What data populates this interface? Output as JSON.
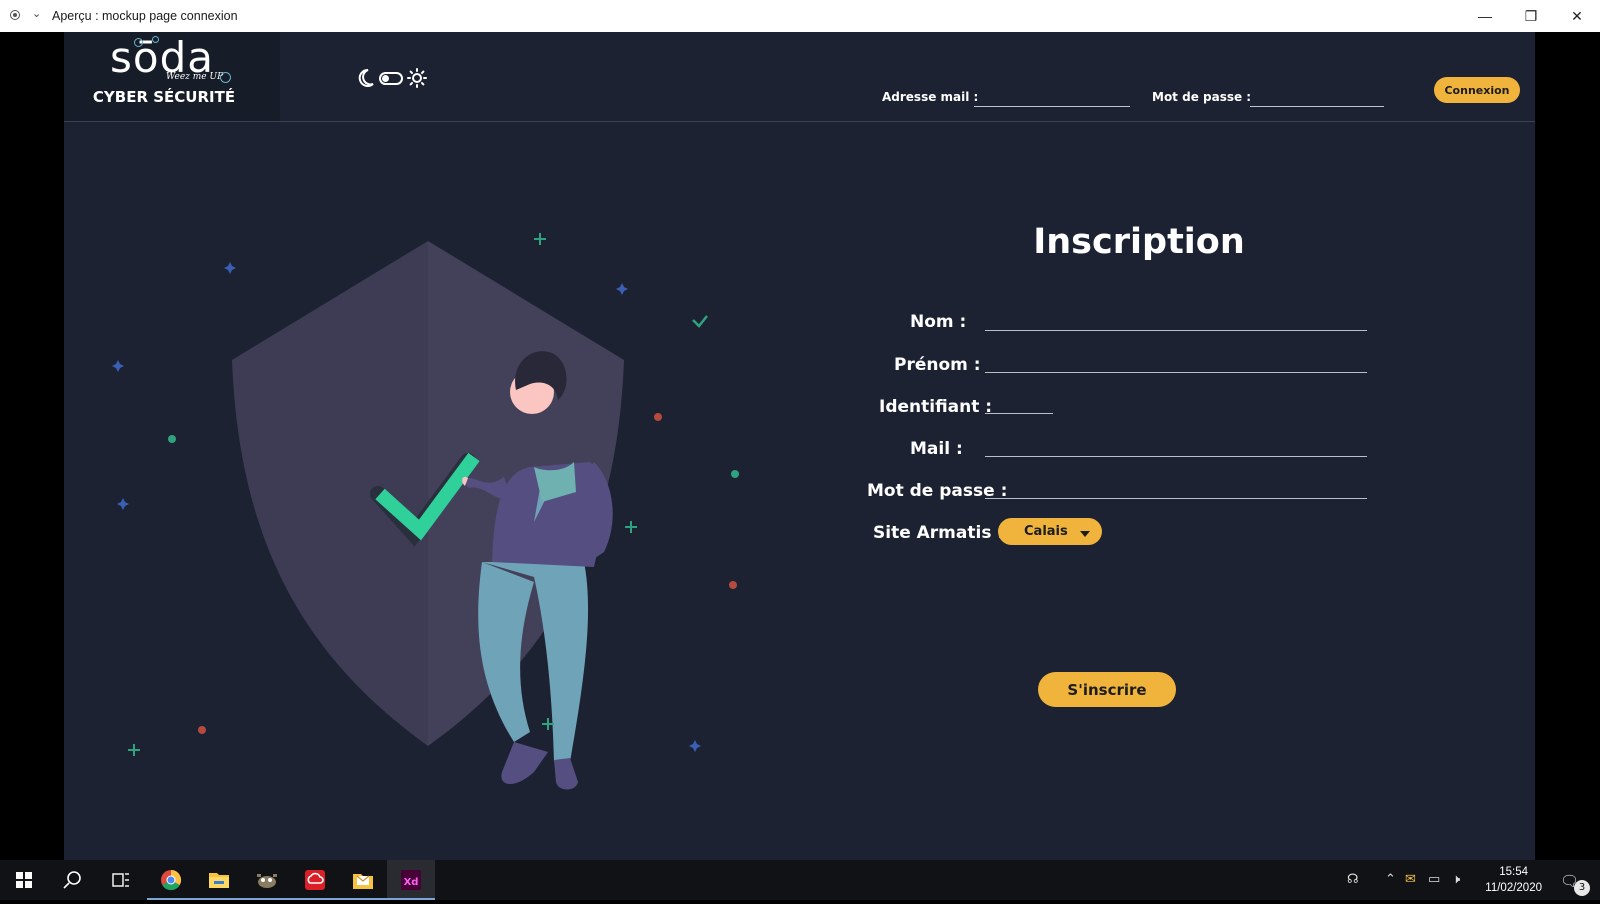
{
  "window": {
    "title": "Aperçu : mockup page connexion",
    "controls": [
      "minimize",
      "restore",
      "close"
    ]
  },
  "header": {
    "logo_word": "sōda",
    "logo_tagline": "Weez me UP",
    "logo_title": "CYBER SÉCURITÉ",
    "email_label": "Adresse mail :",
    "password_label": "Mot de passe :",
    "login_button": "Connexion",
    "theme_icons": [
      "moon-icon",
      "toggle-switch",
      "sun-icon"
    ]
  },
  "form": {
    "title": "Inscription",
    "fields": {
      "nom": "Nom :",
      "prenom": "Prénom :",
      "identifiant": "Identifiant :",
      "mail": "Mail :",
      "password": "Mot de passe :",
      "site": "Site Armatis :"
    },
    "site_selected": "Calais",
    "submit": "S'inscrire"
  },
  "colors": {
    "background": "#1c2232",
    "accent": "#f0b43c",
    "check_green": "#2fd09a",
    "shield": "#3e3c55"
  },
  "taskbar": {
    "apps": [
      "windows-start-icon",
      "search-icon",
      "task-view-icon",
      "chrome-icon",
      "file-explorer-icon",
      "gimp-icon",
      "creative-cloud-icon",
      "mail-folder-icon",
      "adobe-xd-icon"
    ],
    "time": "15:54",
    "date": "11/02/2020",
    "notification_count": "3"
  }
}
